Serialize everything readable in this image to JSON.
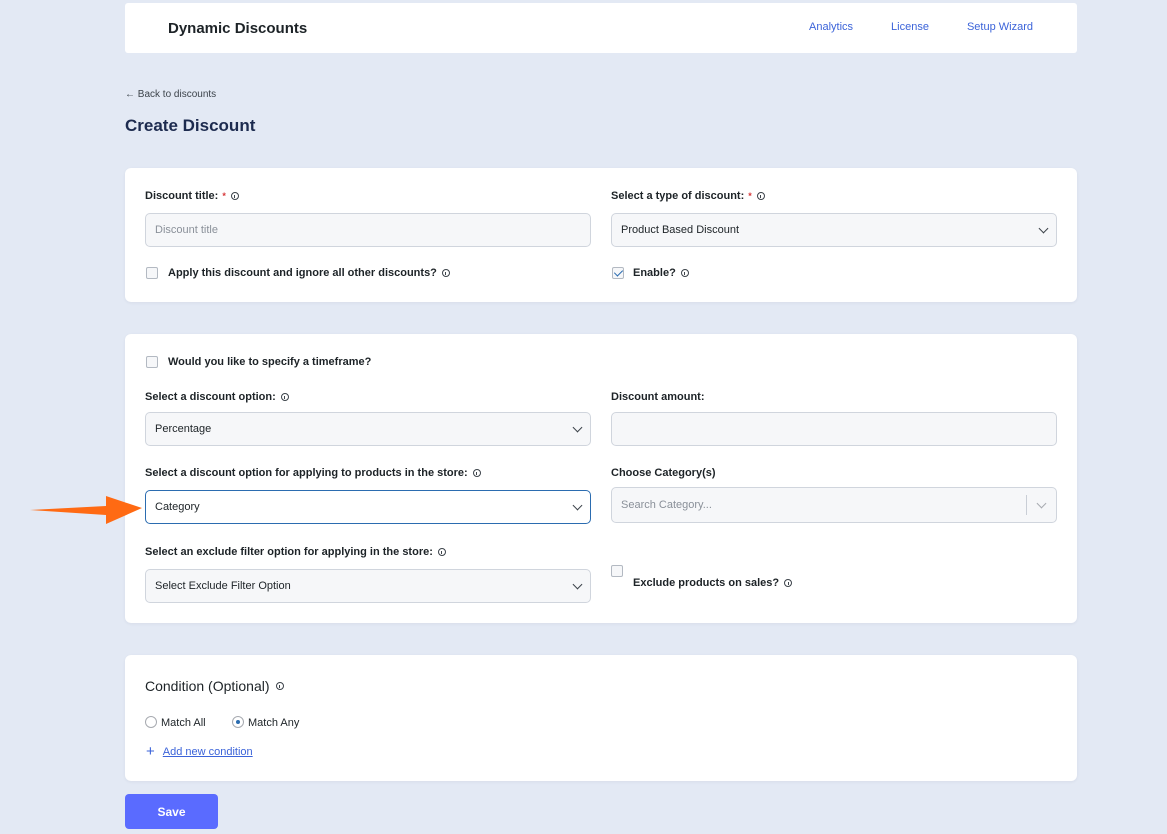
{
  "header": {
    "brand": "Dynamic Discounts",
    "nav": [
      "Analytics",
      "License",
      "Setup Wizard"
    ]
  },
  "back_link": "← Back to discounts",
  "page_title": "Create Discount",
  "general": {
    "title_label": "Discount title:",
    "title_placeholder": "Discount title",
    "type_label": "Select a type of discount:",
    "type_value": "Product Based Discount",
    "ignore_others_label": "Apply this discount and ignore all other discounts?",
    "ignore_others_checked": false,
    "enable_label": "Enable?",
    "enable_checked": true,
    "required_mark": "*"
  },
  "rules": {
    "timeframe_label": "Would you like to specify a timeframe?",
    "timeframe_checked": false,
    "discount_option_label": "Select a discount option:",
    "discount_option_value": "Percentage",
    "amount_label": "Discount amount:",
    "amount_value": "",
    "apply_option_label": "Select a discount option for applying to products in the store:",
    "apply_option_value": "Category",
    "category_label": "Choose Category(s)",
    "category_placeholder": "Search Category...",
    "exclude_label": "Select an exclude filter option for applying in the store:",
    "exclude_value": "Select Exclude Filter Option",
    "exclude_sales_label": "Exclude products on sales?",
    "exclude_sales_checked": false
  },
  "condition": {
    "title": "Condition (Optional)",
    "match_all": "Match All",
    "match_any": "Match Any",
    "selected": "Match Any",
    "add_label": "Add new condition",
    "add_icon": "+"
  },
  "save_label": "Save",
  "colors": {
    "accent": "#5a6bff",
    "link": "#3b63d9",
    "annotation_arrow": "#ff6a13"
  }
}
